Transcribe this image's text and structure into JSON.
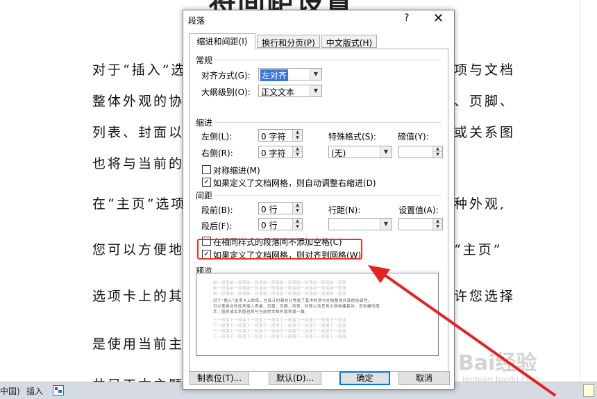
{
  "document": {
    "title": "将间距设置",
    "lines": [
      "对于“插入”选",
      "项与文档",
      "整体外观的协调",
      "、页脚、",
      "列表、封面以及",
      "或关系图",
      "也将与当前的文",
      "在“主页”选项卡",
      "种外观,",
      "您可以方便地更",
      "“主页”",
      "选项卡上的其他",
      "许您选择",
      "是使用当前主题",
      "井目工本主题中"
    ]
  },
  "statusbar": {
    "language": "中国)",
    "insert_mode": "插入"
  },
  "watermark": {
    "text": "Bai经验",
    "sub": "jingyan.baidu.com"
  },
  "dialog": {
    "title": "段落",
    "help": "?",
    "close": "✕",
    "tabs": [
      "缩进和间距(I)",
      "换行和分页(P)",
      "中文版式(H)"
    ],
    "general": {
      "section": "常规",
      "alignment_label": "对齐方式(G):",
      "alignment_value": "左对齐",
      "outline_label": "大纲级别(O):",
      "outline_value": "正文文本"
    },
    "indent": {
      "section": "缩进",
      "left_label": "左侧(L):",
      "left_value": "0 字符",
      "right_label": "右侧(R):",
      "right_value": "0 字符",
      "special_label": "特殊格式(S):",
      "special_value": "(无)",
      "by_label": "磅值(Y):",
      "by_value": "",
      "mirror_label": "对称缩进(M)",
      "mirror_checked": false,
      "auto_adjust_label": "如果定义了文档网格，则自动调整右缩进(D)",
      "auto_adjust_checked": true
    },
    "spacing": {
      "section": "间距",
      "before_label": "段前(B):",
      "before_value": "0 行",
      "after_label": "段后(F):",
      "after_value": "0 行",
      "line_label": "行距(N):",
      "line_value": "",
      "at_label": "设置值(A):",
      "at_value": "",
      "no_space_label": "在相同样式的段落间不添加空格(C)",
      "no_space_checked": false,
      "snap_grid_label": "如果定义了文档网格，则对齐到网格(W)",
      "snap_grid_checked": true
    },
    "preview": {
      "section": "预览",
      "prev_text": "前一段落前一段落前一段落前一段落前一段落前一段落前一段落前一段落",
      "sample_1": "对于“插入”选项卡上的库，在设计时都充分考虑了其中的项与文档整体外观的协调性。",
      "sample_2": "可以使用这些库来插入表格、页眉、页脚、列表、封面以及其他文档构建基块。您创建的图",
      "sample_3": "片、图表或关系图也将与当前的文档外观协调一致。",
      "next_text": "下一段落下一段落下一段落下一段落下一段落下一段落下一段落下一段落"
    },
    "buttons": {
      "tabs": "制表位(T)...",
      "default": "默认(D)...",
      "ok": "确定",
      "cancel": "取消"
    }
  },
  "colors": {
    "highlight": "#e32222",
    "selection": "#3875d7"
  }
}
